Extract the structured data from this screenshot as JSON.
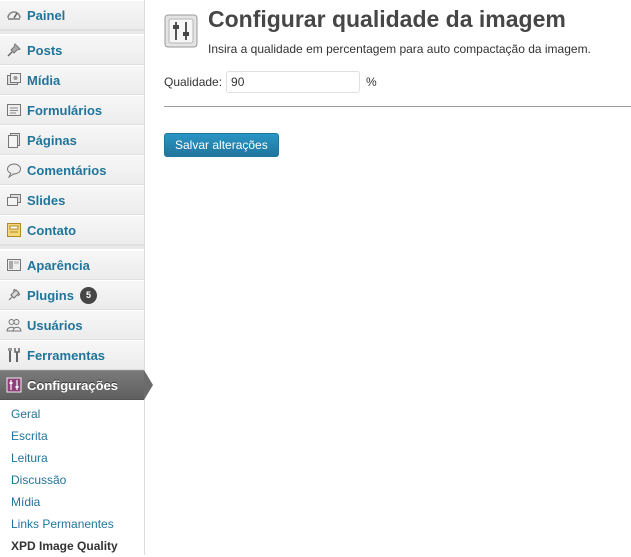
{
  "sidebar": {
    "items": [
      {
        "label": "Painel",
        "icon": "dashboard-icon"
      },
      {
        "label": "Posts",
        "icon": "pin-icon"
      },
      {
        "label": "Mídia",
        "icon": "media-icon"
      },
      {
        "label": "Formulários",
        "icon": "forms-icon"
      },
      {
        "label": "Páginas",
        "icon": "pages-icon"
      },
      {
        "label": "Comentários",
        "icon": "comments-icon"
      },
      {
        "label": "Slides",
        "icon": "slides-icon"
      },
      {
        "label": "Contato",
        "icon": "contact-icon"
      },
      {
        "label": "Aparência",
        "icon": "appearance-icon"
      },
      {
        "label": "Plugins",
        "icon": "plugins-icon",
        "badge": "5"
      },
      {
        "label": "Usuários",
        "icon": "users-icon"
      },
      {
        "label": "Ferramentas",
        "icon": "tools-icon"
      },
      {
        "label": "Configurações",
        "icon": "settings-icon",
        "active": true
      }
    ],
    "submenu": [
      {
        "label": "Geral"
      },
      {
        "label": "Escrita"
      },
      {
        "label": "Leitura"
      },
      {
        "label": "Discussão"
      },
      {
        "label": "Mídia"
      },
      {
        "label": "Links Permanentes"
      },
      {
        "label": "XPD Image Quality",
        "current": true
      }
    ]
  },
  "main": {
    "title": "Configurar qualidade da imagem",
    "description": "Insira a qualidade em percentagem para auto compactação da imagem.",
    "field_label": "Qualidade:",
    "field_value": "90",
    "field_suffix": "%",
    "save_label": "Salvar alterações",
    "page_icon": "sliders-icon"
  },
  "colors": {
    "link": "#21759b",
    "active_menu": "#6b6b6b",
    "button": "#21759b",
    "title": "#464646"
  }
}
